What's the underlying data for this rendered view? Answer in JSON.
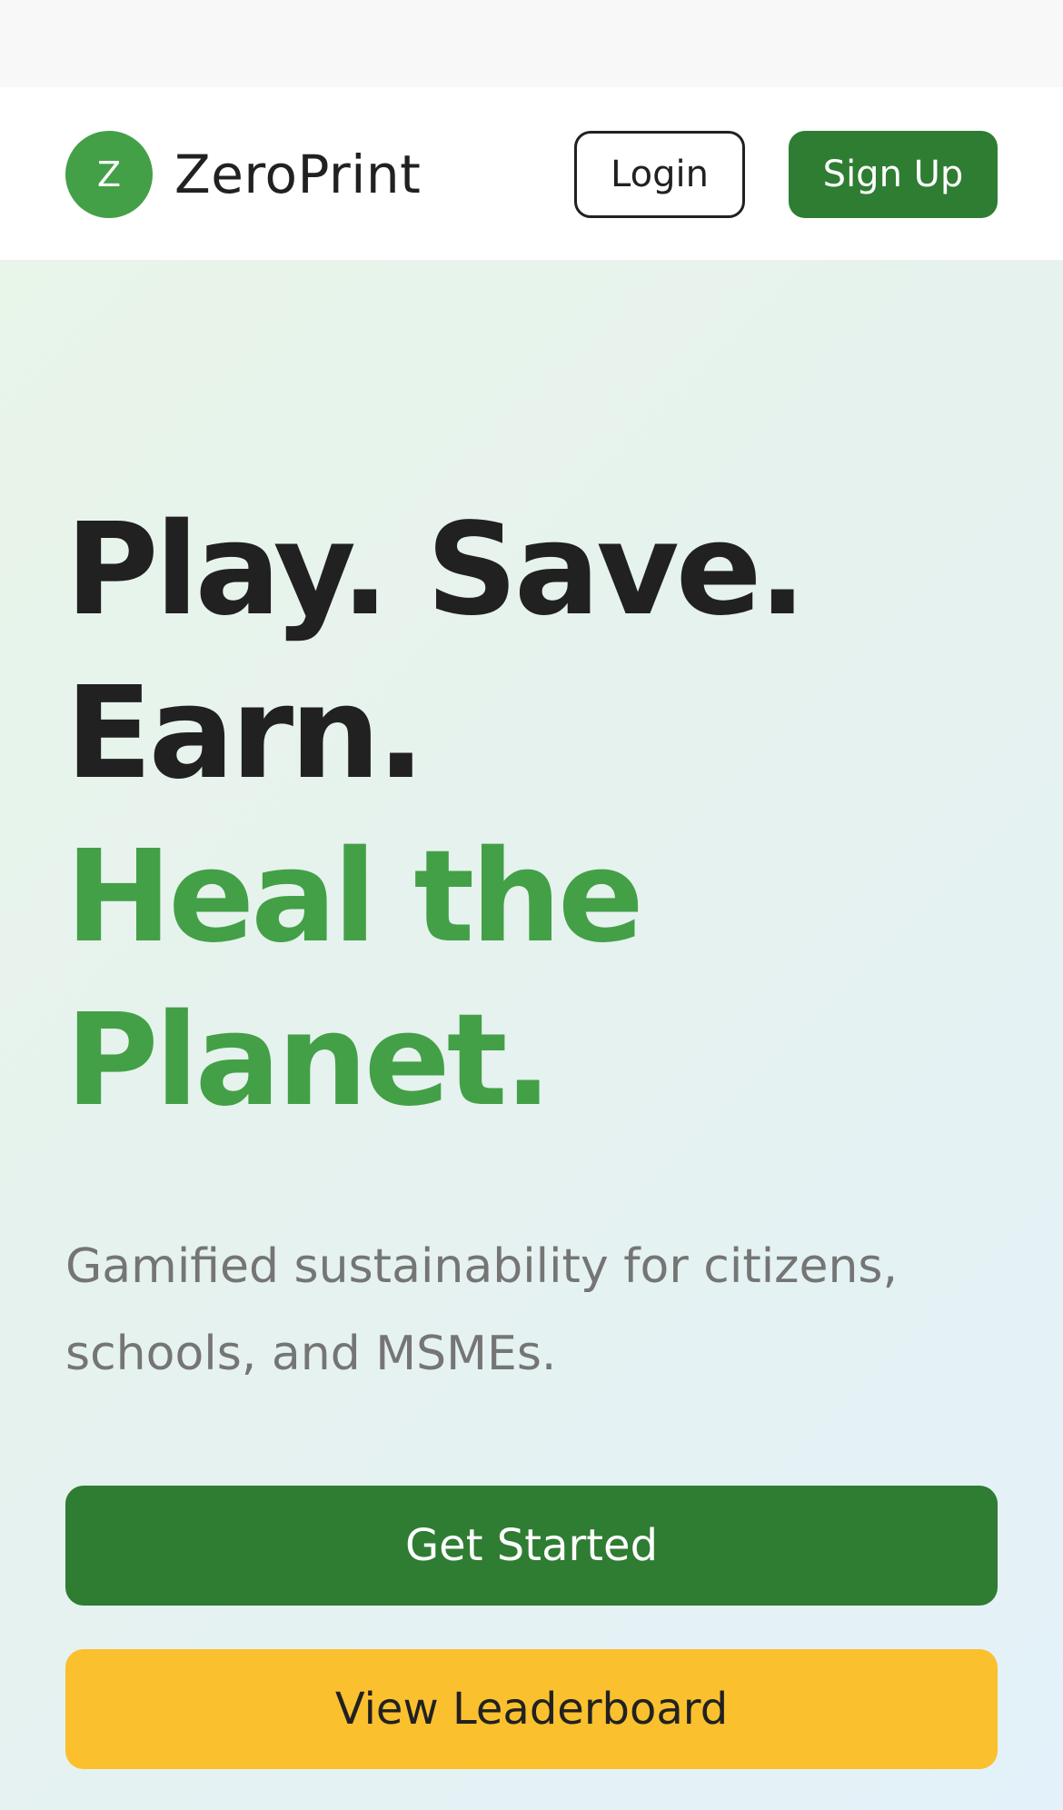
{
  "colors": {
    "brand_green": "#43a047",
    "primary_green": "#2e7d32",
    "accent_yellow": "#fbc02d",
    "text_dark": "#212121",
    "text_muted": "#757575"
  },
  "header": {
    "logo_letter": "Z",
    "brand_name": "ZeroPrint",
    "login_label": "Login",
    "signup_label": "Sign Up"
  },
  "hero": {
    "headline_line1": "Play. Save.",
    "headline_line2": "Earn.",
    "headline_line3": "Heal the",
    "headline_line4": "Planet.",
    "subtitle": "Gamified sustainability for citizens, schools, and MSMEs.",
    "primary_cta": "Get Started",
    "secondary_cta": "View Leaderboard"
  }
}
